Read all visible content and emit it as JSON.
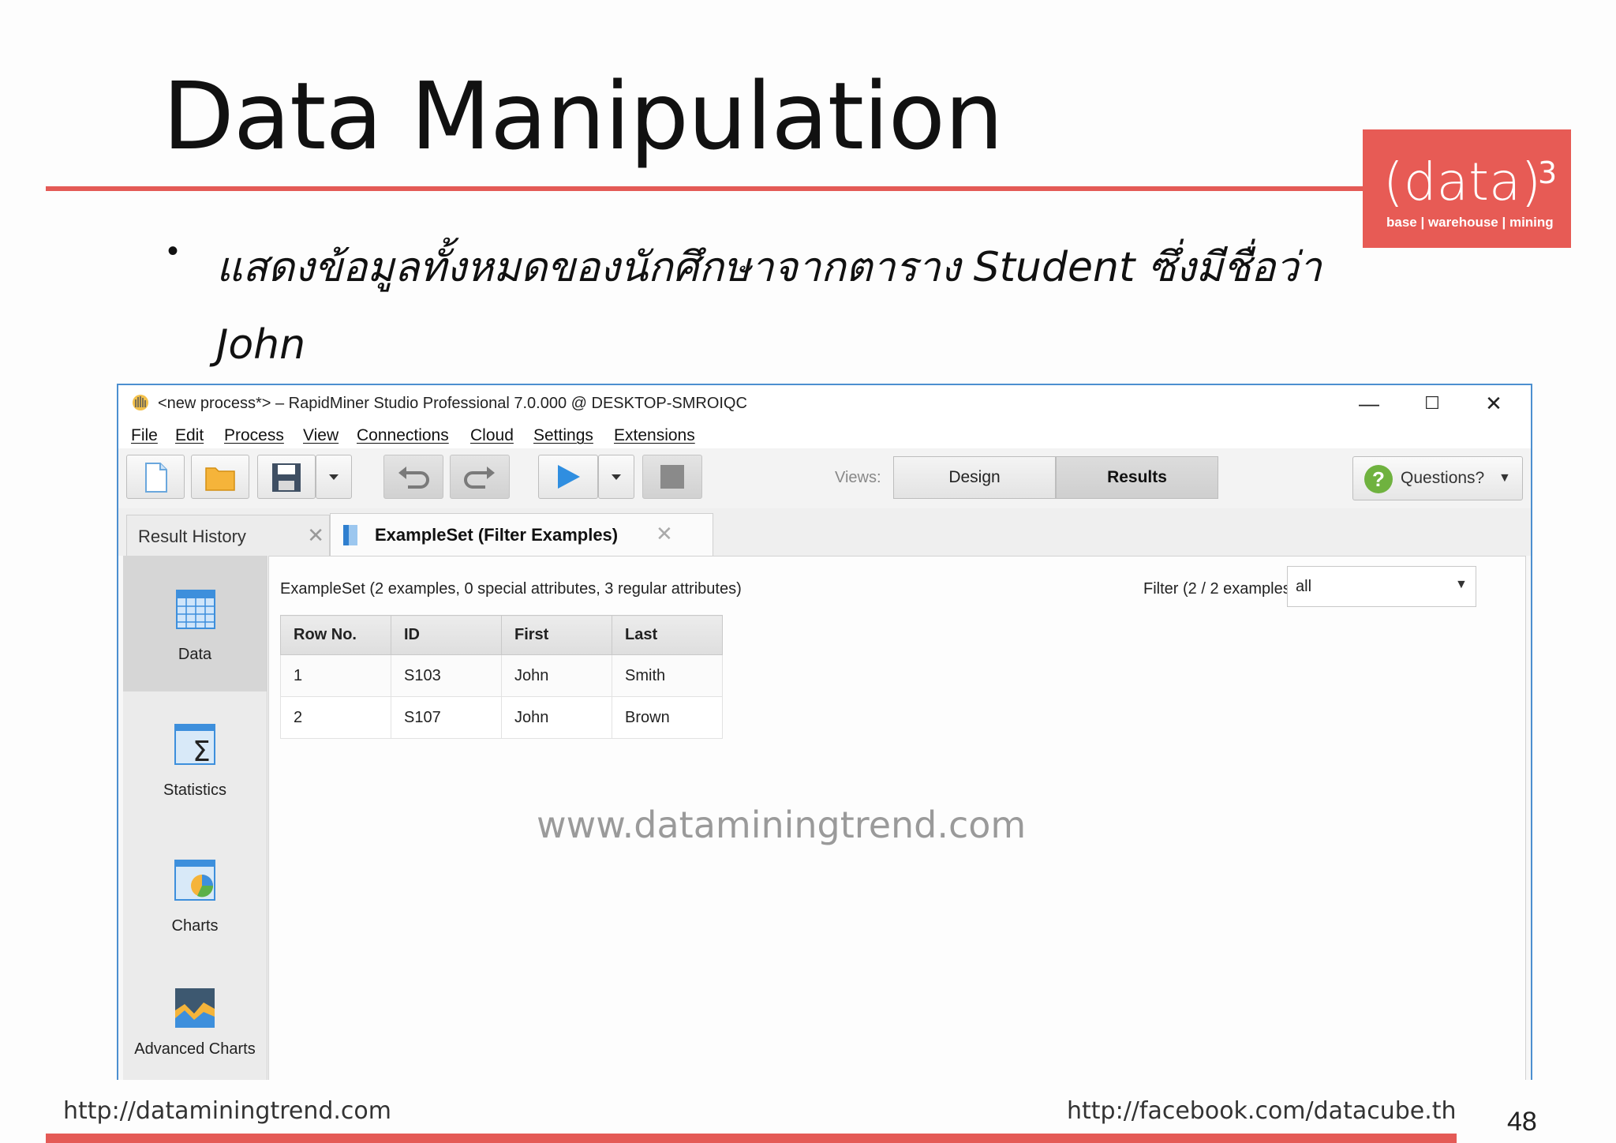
{
  "slide": {
    "title": "Data Manipulation",
    "bullet": "แสดงข้อมูลทั้งหมดของนักศึกษาจากตาราง Student ซึ่งมีชื่อว่า John",
    "logo": {
      "main": "(data)",
      "sup": "3",
      "tagline": "base | warehouse | mining"
    },
    "footer_left": "http://dataminingtrend.com",
    "footer_right": "http://facebook.com/datacube.th",
    "page_number": "48",
    "watermark": "www.dataminingtrend.com",
    "accent_color": "#e45a56"
  },
  "window": {
    "title": "<new process*> – RapidMiner Studio Professional 7.0.000 @ DESKTOP-SMROIQC",
    "controls": {
      "minimize": "—",
      "maximize": "☐",
      "close": "✕"
    },
    "menu": [
      "File",
      "Edit",
      "Process",
      "View",
      "Connections",
      "Cloud",
      "Settings",
      "Extensions"
    ],
    "toolbar": {
      "buttons": [
        "new-process-icon",
        "open-folder-icon",
        "save-icon",
        "dropdown-icon",
        "undo-icon",
        "redo-icon",
        "run-icon",
        "dropdown-icon",
        "stop-icon"
      ],
      "views_label": "Views:",
      "views": [
        "Design",
        "Results"
      ],
      "active_view": "Results",
      "questions": "Questions?"
    }
  },
  "tabs": {
    "history": "Result History",
    "example": "ExampleSet (Filter Examples)"
  },
  "side_panel": [
    "Data",
    "Statistics",
    "Charts",
    "Advanced Charts"
  ],
  "content": {
    "summary": "ExampleSet (2 examples, 0 special attributes, 3 regular attributes)",
    "filter_label": "Filter (2 / 2 examples):",
    "filter_value": "all",
    "columns": [
      "Row No.",
      "ID",
      "First",
      "Last"
    ],
    "rows": [
      [
        "1",
        "S103",
        "John",
        "Smith"
      ],
      [
        "2",
        "S107",
        "John",
        "Brown"
      ]
    ]
  }
}
